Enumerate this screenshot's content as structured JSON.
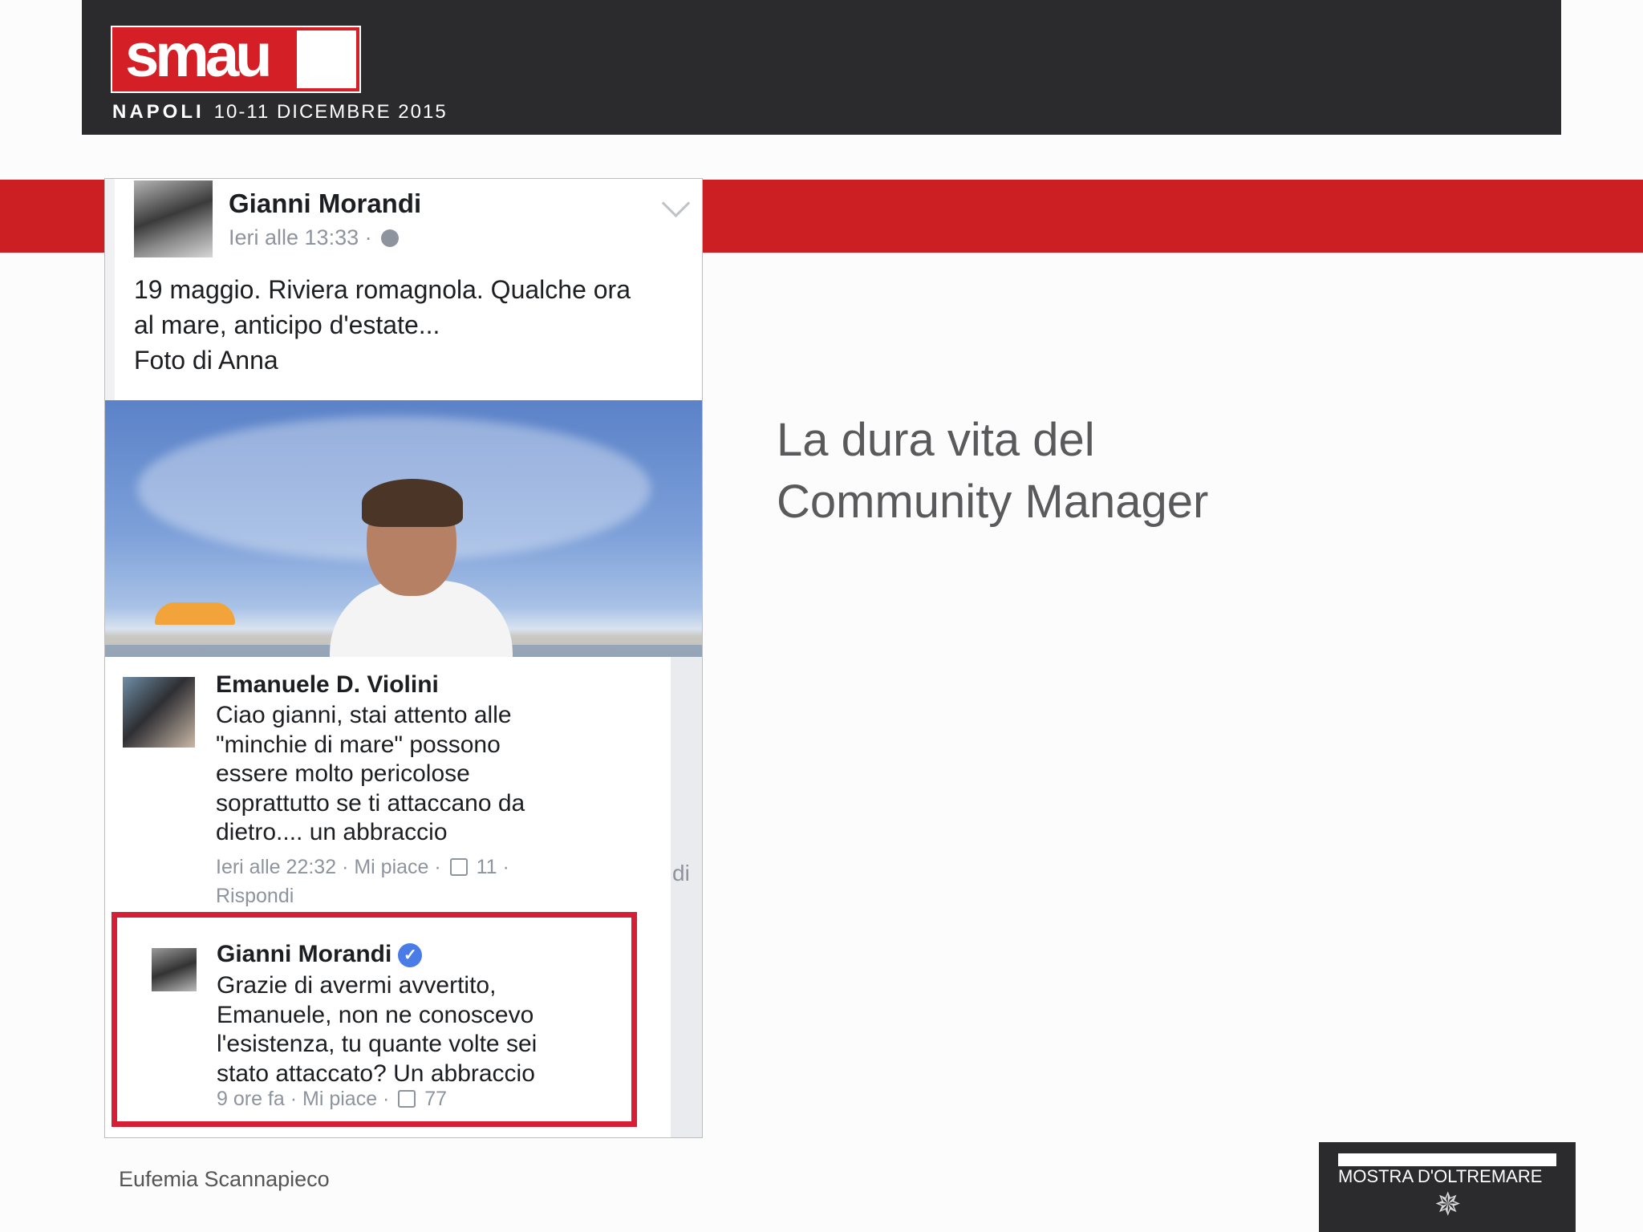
{
  "header": {
    "logo_text": "smau",
    "city": "NAPOLI",
    "dates": "10-11 DICEMBRE 2015"
  },
  "post": {
    "author": "Gianni Morandi",
    "time": "Ieri alle 13:33 ·",
    "text_lines": [
      "19 maggio. Riviera romagnola. Qualche ora",
      "al mare, anticipo d'estate...",
      "Foto di Anna"
    ]
  },
  "comment": {
    "author": "Emanuele D. Violini",
    "text_lines": [
      "Ciao gianni, stai attento alle",
      "\"minchie di mare\" possono",
      "essere molto pericolose",
      "soprattutto se ti attaccano da",
      "dietro.... un abbraccio"
    ],
    "time": "Ieri alle 22:32",
    "like_label": "· Mi piace ·",
    "likes": "11 ·",
    "reply_label": "Rispondi"
  },
  "reply": {
    "author": "Gianni Morandi",
    "verified_mark": "✓",
    "text_lines": [
      "Grazie di avermi avvertito,",
      "Emanuele, non ne conoscevo",
      "l'esistenza, tu quante volte sei",
      "stato attaccato? Un abbraccio"
    ],
    "time": "9 ore fa",
    "like_label": "· Mi piace ·",
    "likes": "77"
  },
  "side_partial_text": "di",
  "title_lines": [
    "La dura vita del",
    "Community Manager"
  ],
  "footer": {
    "author": "Eufemia Scannapieco",
    "venue": "MOSTRA D'OLTREMARE"
  },
  "colors": {
    "brand_red": "#cc1f24",
    "header_dark": "#2b2b2d",
    "highlight_border": "#d41f37",
    "verified_blue": "#4a7ce8"
  }
}
